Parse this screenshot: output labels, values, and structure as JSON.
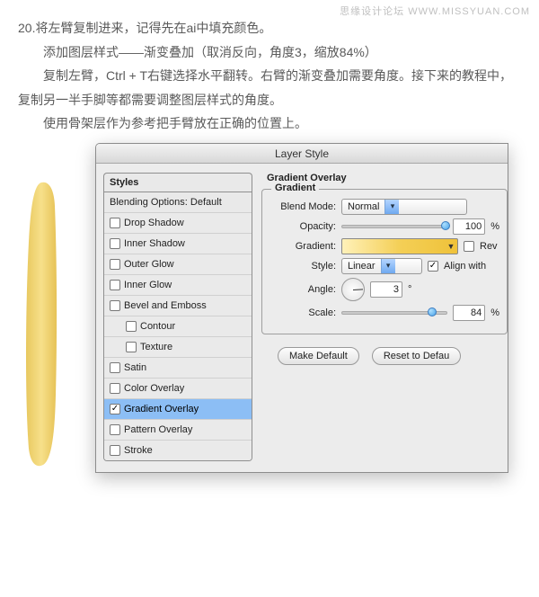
{
  "watermark": "思缘设计论坛   WWW.MISSYUAN.COM",
  "article": {
    "p1": "20.将左臂复制进来，记得先在ai中填充颜色。",
    "p2": "添加图层样式——渐变叠加（取消反向，角度3，缩放84%）",
    "p3": "复制左臂，Ctrl + T右键选择水平翻转。右臂的渐变叠加需要角度。接下来的教程中，复制另一半手脚等都需要调整图层样式的角度。",
    "p4": "使用骨架层作为参考把手臂放在正确的位置上。"
  },
  "dialog": {
    "title": "Layer Style",
    "styles_header": "Styles",
    "blending_default": "Blending Options: Default",
    "items": {
      "drop_shadow": "Drop Shadow",
      "inner_shadow": "Inner Shadow",
      "outer_glow": "Outer Glow",
      "inner_glow": "Inner Glow",
      "bevel_emboss": "Bevel and Emboss",
      "contour": "Contour",
      "texture": "Texture",
      "satin": "Satin",
      "color_overlay": "Color Overlay",
      "gradient_overlay": "Gradient Overlay",
      "pattern_overlay": "Pattern Overlay",
      "stroke": "Stroke"
    },
    "panel": {
      "group_title": "Gradient Overlay",
      "sub_title": "Gradient",
      "blend_mode_label": "Blend Mode:",
      "blend_mode_value": "Normal",
      "opacity_label": "Opacity:",
      "opacity_value": "100",
      "opacity_unit": "%",
      "gradient_label": "Gradient:",
      "reverse_label": "Rev",
      "style_label": "Style:",
      "style_value": "Linear",
      "align_label": "Align with",
      "angle_label": "Angle:",
      "angle_value": "3",
      "angle_unit": "°",
      "scale_label": "Scale:",
      "scale_value": "84",
      "scale_unit": "%",
      "make_default": "Make Default",
      "reset_default": "Reset to Defau"
    }
  }
}
